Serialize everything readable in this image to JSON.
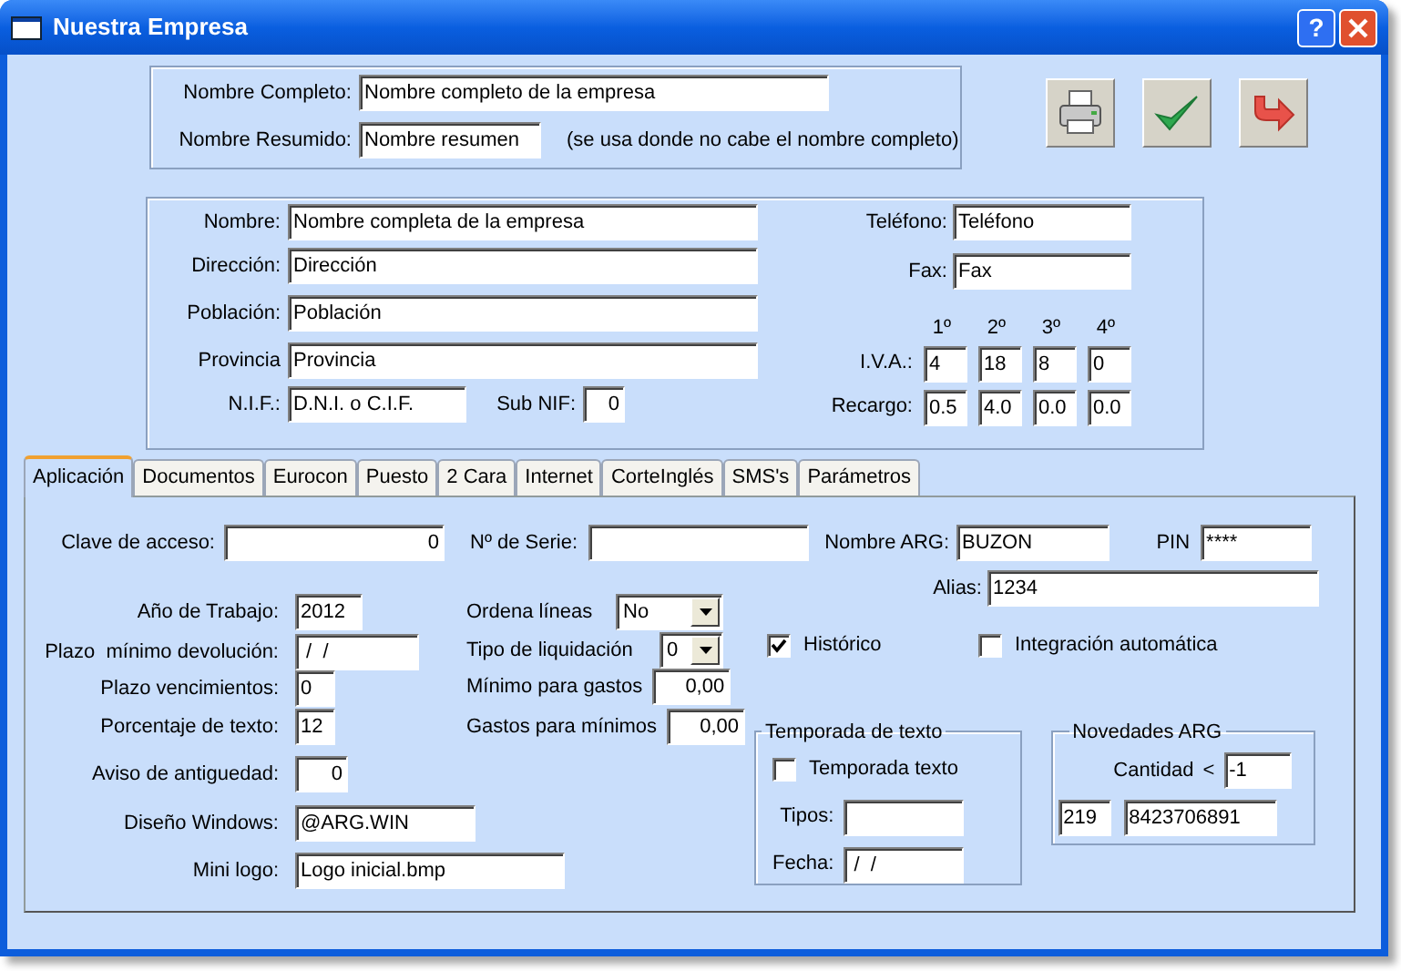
{
  "window": {
    "title": "Nuestra Empresa",
    "help": "?"
  },
  "names": {
    "full": {
      "label": "Nombre Completo:",
      "value": "Nombre completo de la empresa"
    },
    "short": {
      "label": "Nombre Resumido:",
      "value": "Nombre resumen"
    },
    "note": "(se usa donde no cabe el nombre completo)"
  },
  "toolbar": [
    {
      "kind": "print"
    },
    {
      "kind": "accept"
    },
    {
      "kind": "exit"
    }
  ],
  "company": {
    "fields": [
      {
        "label": "Nombre:",
        "value": "Nombre completa de la empresa"
      },
      {
        "label": "Dirección:",
        "value": "Dirección"
      },
      {
        "label": "Población:",
        "value": "Población"
      },
      {
        "label": "Provincia",
        "value": "Provincia"
      }
    ],
    "nif": {
      "label": "N.I.F.:",
      "value": "D.N.I. o C.I.F."
    },
    "sub_nif": {
      "label": "Sub NIF:",
      "value": "0"
    },
    "telefono": {
      "label": "Teléfono:",
      "value": "Teléfono"
    },
    "fax": {
      "label": "Fax:",
      "value": "Fax"
    }
  },
  "taxes": {
    "headers": [
      "1º",
      "2º",
      "3º",
      "4º"
    ],
    "iva": {
      "label": "I.V.A.:",
      "values": [
        "4",
        "18",
        "8",
        "0"
      ]
    },
    "recargo": {
      "label": "Recargo:",
      "values": [
        "0.5",
        "4.0",
        "0.0",
        "0.0"
      ]
    }
  },
  "tabs": [
    {
      "label": "Aplicación",
      "selected": true
    },
    {
      "label": "Documentos",
      "selected": false
    },
    {
      "label": "Eurocon",
      "selected": false
    },
    {
      "label": "Puesto",
      "selected": false
    },
    {
      "label": "2 Cara",
      "selected": false
    },
    {
      "label": "Internet",
      "selected": false
    },
    {
      "label": "CorteInglés",
      "selected": false
    },
    {
      "label": "SMS's",
      "selected": false
    },
    {
      "label": "Parámetros",
      "selected": false
    }
  ],
  "app": {
    "clave": {
      "label": "Clave de acceso:",
      "value": "0"
    },
    "serie": {
      "label": "Nº de Serie:"
    },
    "nombre_arg": {
      "label": "Nombre ARG:",
      "value": "BUZON"
    },
    "pin": {
      "label": "PIN",
      "value": "****"
    },
    "alias": {
      "label": "Alias:",
      "value": "1234"
    },
    "left": [
      {
        "label": "Año de Trabajo:",
        "value": "2012"
      },
      {
        "label": "Plazo  mínimo devolución:",
        "value": " /  /"
      },
      {
        "label": "Plazo vencimientos:",
        "value": "0"
      },
      {
        "label": "Porcentaje de texto:",
        "value": "12"
      },
      {
        "label": "Aviso de antiguedad:",
        "value": "0"
      },
      {
        "label": "Diseño Windows:",
        "value": "@ARG.WIN"
      },
      {
        "label": "Mini logo:",
        "value": "Logo inicial.bmp"
      }
    ],
    "middle": [
      {
        "kind": "select",
        "label": "Ordena líneas",
        "value": "No"
      },
      {
        "kind": "select",
        "label": "Tipo de liquidación",
        "value": "0"
      },
      {
        "kind": "input",
        "label": "Mínimo para gastos",
        "value": "0,00"
      },
      {
        "kind": "input",
        "label": "Gastos para mínimos",
        "value": "0,00"
      }
    ],
    "checks": [
      {
        "label": "Histórico",
        "checked": true
      },
      {
        "label": "Integración automática",
        "checked": false
      }
    ]
  },
  "temporada": {
    "title": "Temporada de texto",
    "check": {
      "label": "Temporada texto",
      "checked": false
    },
    "tipos": {
      "label": "Tipos:"
    },
    "fecha": {
      "label": "Fecha:",
      "value": " /  /"
    }
  },
  "novedades": {
    "title": "Novedades ARG",
    "cantidad": {
      "label": "Cantidad",
      "operator": "<",
      "value": "-1"
    },
    "codes": [
      "219",
      "8423706891"
    ]
  }
}
